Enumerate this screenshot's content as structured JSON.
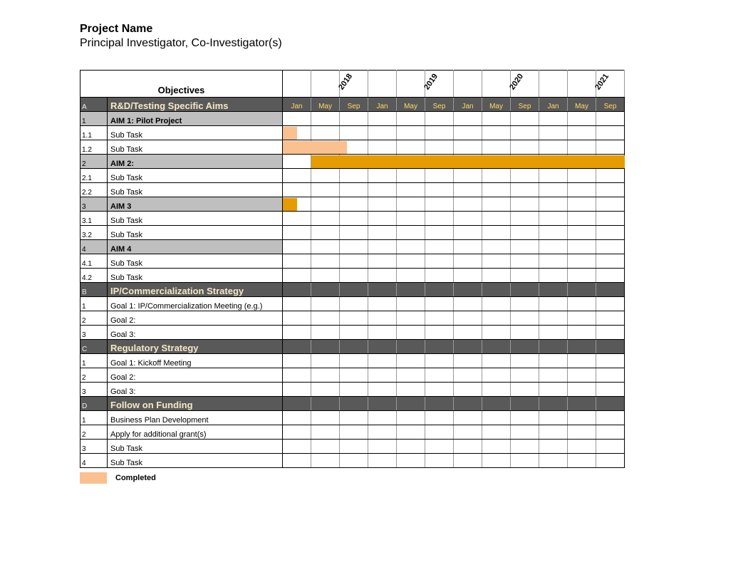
{
  "heading": {
    "title": "Project Name",
    "subtitle": "Principal Investigator, Co-Investigator(s)"
  },
  "objectives_label": "Objectives",
  "years": [
    "2018",
    "2019",
    "2020",
    "2021"
  ],
  "months": [
    "Jan",
    "May",
    "Sep"
  ],
  "months_per_year": 3,
  "total_cols": 12,
  "colors": {
    "completed": "#fac090",
    "active": "#e69b00",
    "section_bg": "#595959",
    "aim_bg": "#bfbfbf"
  },
  "legend": {
    "label": "Completed",
    "swatch": "completed"
  },
  "chart_data": {
    "type": "table",
    "title": "Gantt Chart – Objectives vs Timeline (2018–2021, quarterly columns Jan/May/Sep)",
    "column_unit": "one column ≈ 4 months",
    "rows": [
      {
        "kind": "section",
        "idx": "A",
        "label": "R&D/Testing Specific Aims",
        "show_months": true
      },
      {
        "kind": "aim",
        "idx": "1",
        "label": "AIM 1: Pilot Project"
      },
      {
        "kind": "task",
        "idx": "1.1",
        "label": "Sub Task",
        "bars": [
          {
            "type": "completed",
            "start_col": 0,
            "span_cols": 0.5
          }
        ]
      },
      {
        "kind": "task",
        "idx": "1.2",
        "label": "Sub Task",
        "bars": [
          {
            "type": "completed",
            "start_col": 0,
            "span_cols": 2.25
          }
        ]
      },
      {
        "kind": "aim",
        "idx": "2",
        "label": "AIM 2:",
        "bars": [
          {
            "type": "active",
            "start_col": 1,
            "span_cols": 11
          }
        ]
      },
      {
        "kind": "task",
        "idx": "2.1",
        "label": "Sub Task"
      },
      {
        "kind": "task",
        "idx": "2.2",
        "label": "Sub Task"
      },
      {
        "kind": "aim",
        "idx": "3",
        "label": "AIM 3",
        "bars": [
          {
            "type": "active",
            "start_col": 0,
            "span_cols": 0.5
          }
        ]
      },
      {
        "kind": "task",
        "idx": "3.1",
        "label": "Sub Task"
      },
      {
        "kind": "task",
        "idx": "3.2",
        "label": "Sub Task"
      },
      {
        "kind": "aim",
        "idx": "4",
        "label": "AIM 4"
      },
      {
        "kind": "task",
        "idx": "4.1",
        "label": "Sub Task"
      },
      {
        "kind": "task",
        "idx": "4.2",
        "label": "Sub Task"
      },
      {
        "kind": "section",
        "idx": "B",
        "label": "IP/Commercialization Strategy",
        "show_months": false
      },
      {
        "kind": "task",
        "idx": "1",
        "label": "Goal 1: IP/Commercialization Meeting (e.g.)"
      },
      {
        "kind": "task",
        "idx": "2",
        "label": "Goal 2:"
      },
      {
        "kind": "task",
        "idx": "3",
        "label": "Goal 3:"
      },
      {
        "kind": "section",
        "idx": "C",
        "label": "Regulatory Strategy",
        "show_months": false
      },
      {
        "kind": "task",
        "idx": "1",
        "label": "Goal 1: Kickoff Meeting"
      },
      {
        "kind": "task",
        "idx": "2",
        "label": "Goal 2:"
      },
      {
        "kind": "task",
        "idx": "3",
        "label": "Goal 3:"
      },
      {
        "kind": "section",
        "idx": "D",
        "label": "Follow on Funding",
        "show_months": false
      },
      {
        "kind": "task",
        "idx": "1",
        "label": "Business Plan Development"
      },
      {
        "kind": "task",
        "idx": "2",
        "label": "Apply for additional grant(s)"
      },
      {
        "kind": "task",
        "idx": "3",
        "label": "Sub Task"
      },
      {
        "kind": "task",
        "idx": "4",
        "label": "Sub Task"
      }
    ]
  }
}
